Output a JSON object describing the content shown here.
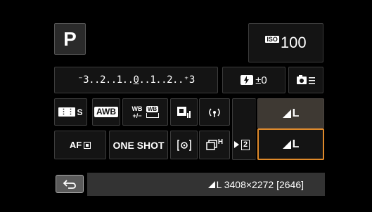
{
  "mode": {
    "label": "P"
  },
  "iso": {
    "badge": "ISO",
    "value": "100"
  },
  "exposure": {
    "scale_prefix": "⁻3..2..1..",
    "scale_zero": "0",
    "scale_suffix": "..1..2..⁺3"
  },
  "flash_comp": {
    "value": "±0"
  },
  "row3": {
    "picture_style": "S",
    "wb": "AWB",
    "wb_shift_top": "WB",
    "wb_shift_bottom": "+/−",
    "wb_bracket": "WB"
  },
  "row4": {
    "af_label": "AF",
    "af_mode": "ONE SHOT",
    "drive_badge": "H"
  },
  "card": {
    "label": "2"
  },
  "quality": {
    "upper": "L",
    "lower": "L"
  },
  "footer": {
    "quality_text": "L 3408×2272 [2646]"
  },
  "colors": {
    "highlight": "#e08a2a",
    "panel": "#141414",
    "border": "#3c3c3c"
  }
}
